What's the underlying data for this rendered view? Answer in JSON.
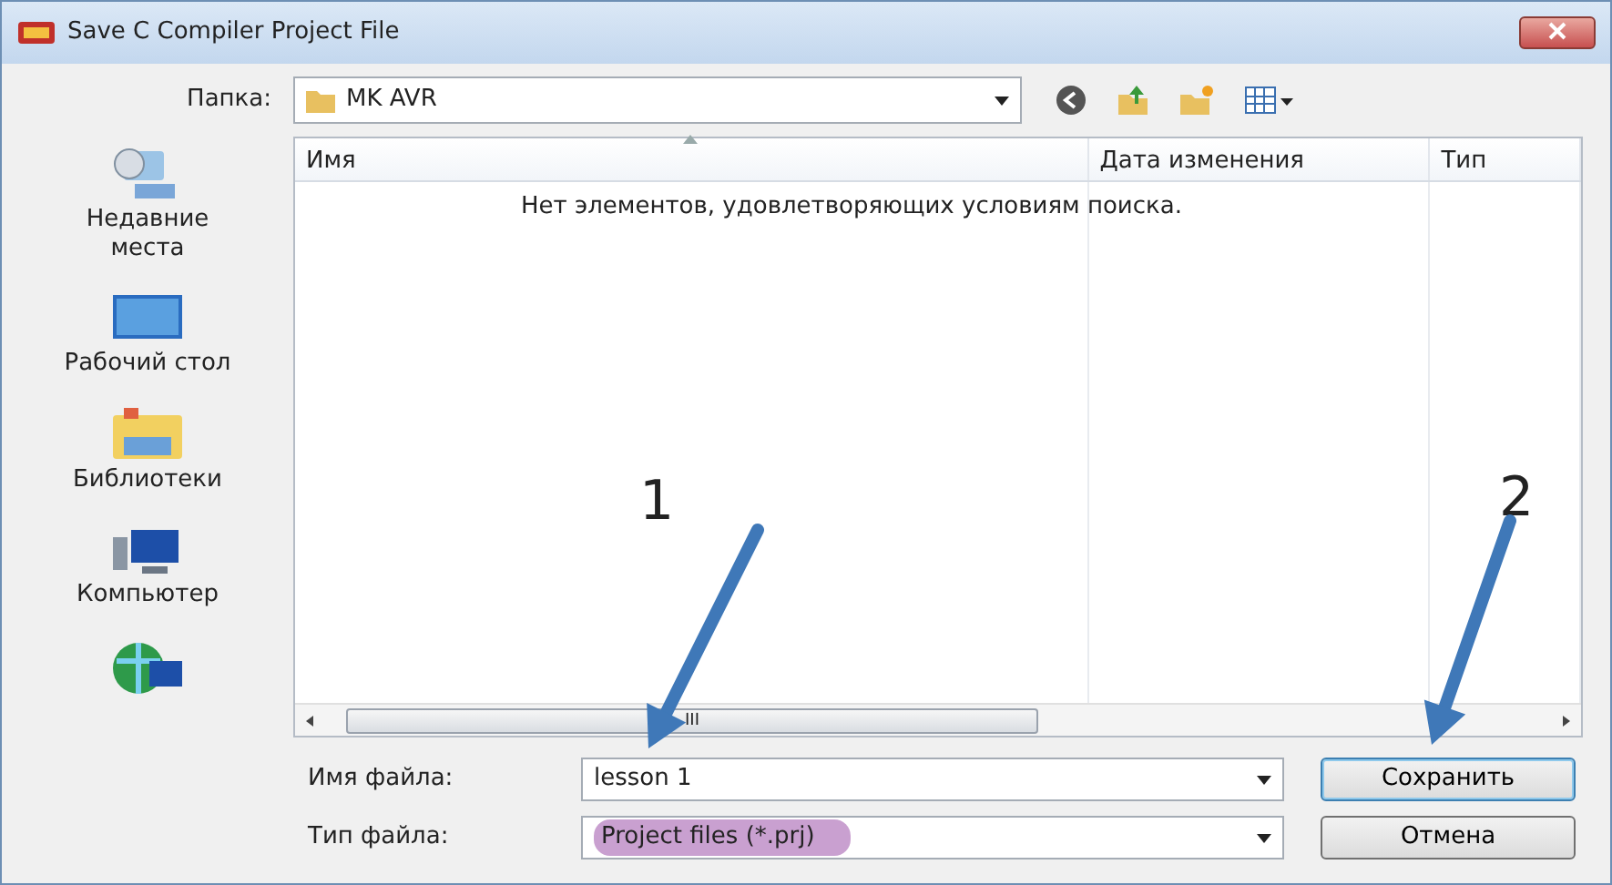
{
  "window": {
    "title": "Save C Compiler Project File"
  },
  "folder": {
    "label": "Папка:",
    "value": "MK AVR"
  },
  "sidebar": {
    "items": [
      {
        "kind": "recent",
        "label": "Недавние места"
      },
      {
        "kind": "desktop",
        "label": "Рабочий стол"
      },
      {
        "kind": "libraries",
        "label": "Библиотеки"
      },
      {
        "kind": "computer",
        "label": "Компьютер"
      },
      {
        "kind": "network"
      }
    ]
  },
  "table": {
    "columns": [
      {
        "label": "Имя",
        "sorted": true
      },
      {
        "label": "Дата изменения",
        "sorted": false
      },
      {
        "label": "Тип",
        "sorted": false
      }
    ],
    "empty_message": "Нет элементов, удовлетворяющих условиям поиска."
  },
  "scrollbar": {
    "grip": "III"
  },
  "filename": {
    "label": "Имя файла:",
    "value": "lesson 1"
  },
  "filetype": {
    "label": "Тип файла:",
    "value": "Project files (*.prj)",
    "highlighted": true
  },
  "buttons": [
    {
      "label": "Сохранить",
      "default": true
    },
    {
      "label": "Отмена",
      "default": false
    }
  ],
  "annotations": [
    {
      "number": "1"
    },
    {
      "number": "2"
    }
  ]
}
